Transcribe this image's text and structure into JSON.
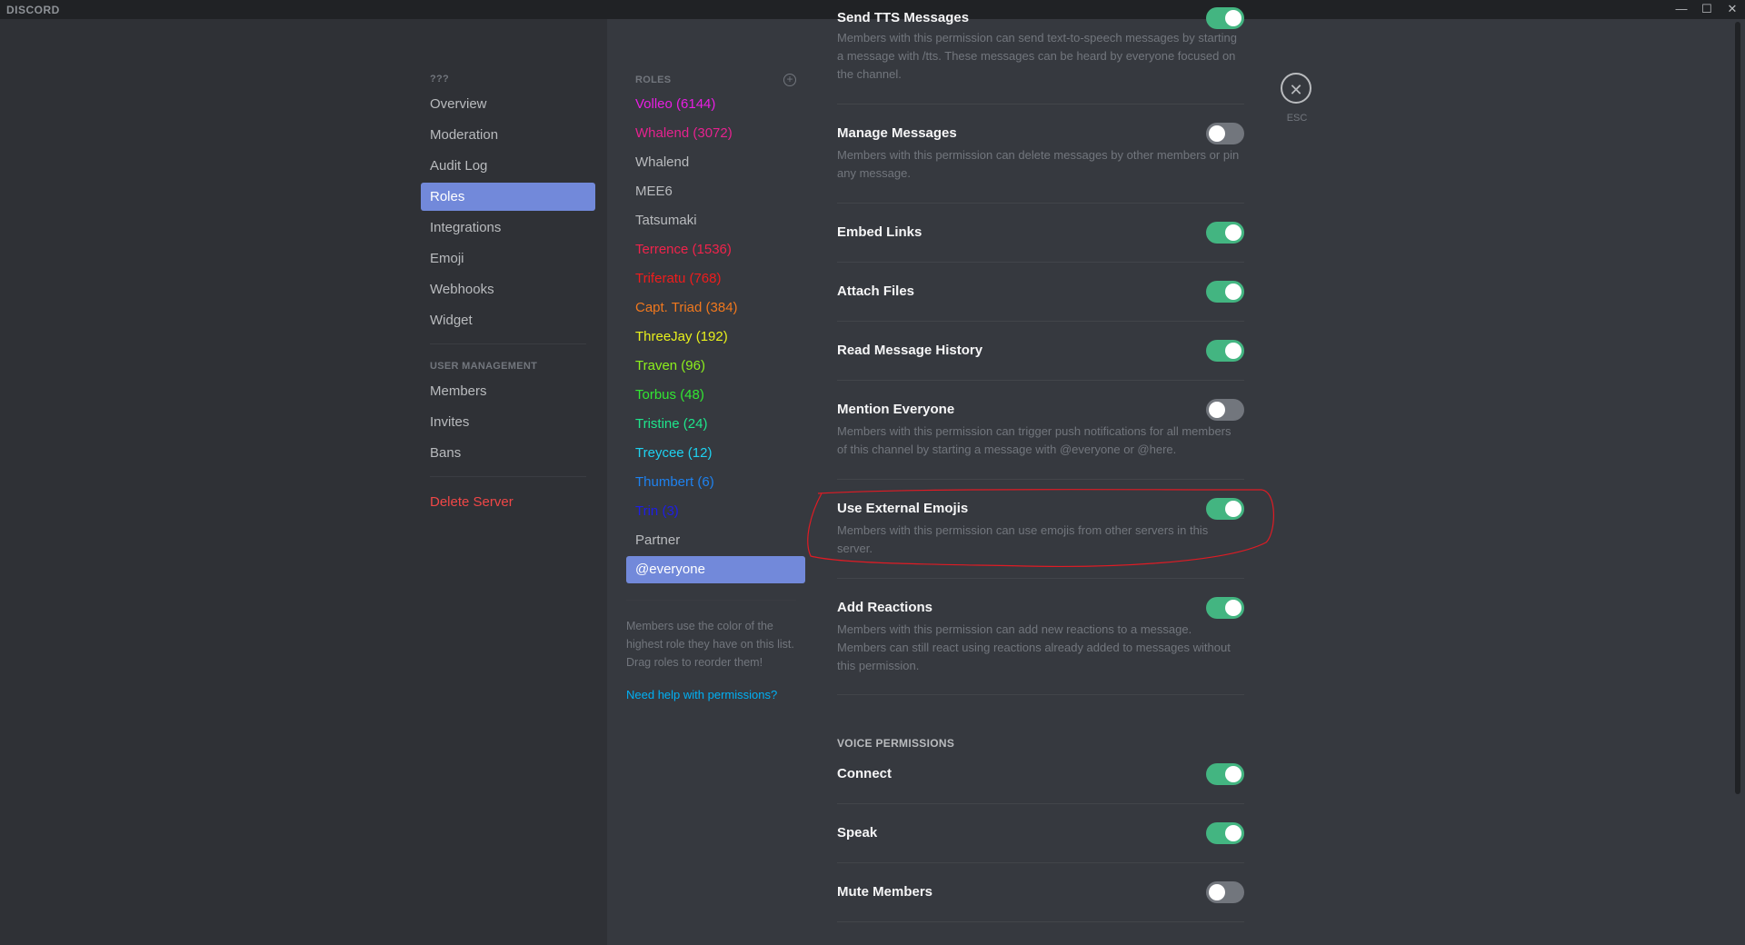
{
  "titlebar": {
    "brand": "DISCORD",
    "minimize_icon": "—",
    "maximize_icon": "☐",
    "close_icon": "✕"
  },
  "nav": {
    "server_header": "???",
    "items": [
      {
        "label": "Overview"
      },
      {
        "label": "Moderation"
      },
      {
        "label": "Audit Log"
      },
      {
        "label": "Roles",
        "selected": true
      },
      {
        "label": "Integrations"
      },
      {
        "label": "Emoji"
      },
      {
        "label": "Webhooks"
      },
      {
        "label": "Widget"
      }
    ],
    "user_management_header": "USER MANAGEMENT",
    "user_items": [
      {
        "label": "Members"
      },
      {
        "label": "Invites"
      },
      {
        "label": "Bans"
      }
    ],
    "delete_label": "Delete Server"
  },
  "roles": {
    "header": "ROLES",
    "items": [
      {
        "label": "Volleo (6144)",
        "color": "#e91ee3"
      },
      {
        "label": "Whalend (3072)",
        "color": "#e6228f"
      },
      {
        "label": "Whalend",
        "color": "#b9bbbe"
      },
      {
        "label": "MEE6",
        "color": "#b9bbbe"
      },
      {
        "label": "Tatsumaki",
        "color": "#b9bbbe"
      },
      {
        "label": "Terrence (1536)",
        "color": "#f0234b"
      },
      {
        "label": "Triferatu (768)",
        "color": "#f01c1c"
      },
      {
        "label": "Capt. Triad (384)",
        "color": "#f0781e"
      },
      {
        "label": "ThreeJay (192)",
        "color": "#e8f01c"
      },
      {
        "label": "Traven (96)",
        "color": "#8cf01c"
      },
      {
        "label": "Torbus (48)",
        "color": "#32e632"
      },
      {
        "label": "Tristine (24)",
        "color": "#1ee68c"
      },
      {
        "label": "Treycee (12)",
        "color": "#1ed2f0"
      },
      {
        "label": "Thumbert (6)",
        "color": "#1e82f0"
      },
      {
        "label": "Trin (3)",
        "color": "#1e1ee6"
      },
      {
        "label": "Partner",
        "color": "#b9bbbe"
      },
      {
        "label": "@everyone",
        "color": "#ffffff",
        "selected": true
      }
    ],
    "note": "Members use the color of the highest role they have on this list. Drag roles to reorder them!",
    "help_link": "Need help with permissions?"
  },
  "permissions": [
    {
      "title": "Send TTS Messages",
      "desc": "Members with this permission can send text-to-speech messages by starting a message with /tts. These messages can be heard by everyone focused on the channel.",
      "enabled": true
    },
    {
      "title": "Manage Messages",
      "desc": "Members with this permission can delete messages by other members or pin any message.",
      "enabled": false
    },
    {
      "title": "Embed Links",
      "desc": "",
      "enabled": true
    },
    {
      "title": "Attach Files",
      "desc": "",
      "enabled": true
    },
    {
      "title": "Read Message History",
      "desc": "",
      "enabled": true
    },
    {
      "title": "Mention Everyone",
      "desc": "Members with this permission can trigger push notifications for all members of this channel by starting a message with @everyone or @here.",
      "enabled": false
    },
    {
      "title": "Use External Emojis",
      "desc": "Members with this permission can use emojis from other servers in this server.",
      "enabled": true
    },
    {
      "title": "Add Reactions",
      "desc": "Members with this permission can add new reactions to a message. Members can still react using reactions already added to messages without this permission.",
      "enabled": true
    }
  ],
  "voice": {
    "header": "VOICE PERMISSIONS",
    "items": [
      {
        "title": "Connect",
        "enabled": true
      },
      {
        "title": "Speak",
        "enabled": true
      },
      {
        "title": "Mute Members",
        "enabled": false
      }
    ]
  },
  "close": {
    "icon": "✕",
    "label": "ESC"
  },
  "annotation": {
    "color": "#e01b24",
    "target": "Use External Emojis"
  }
}
